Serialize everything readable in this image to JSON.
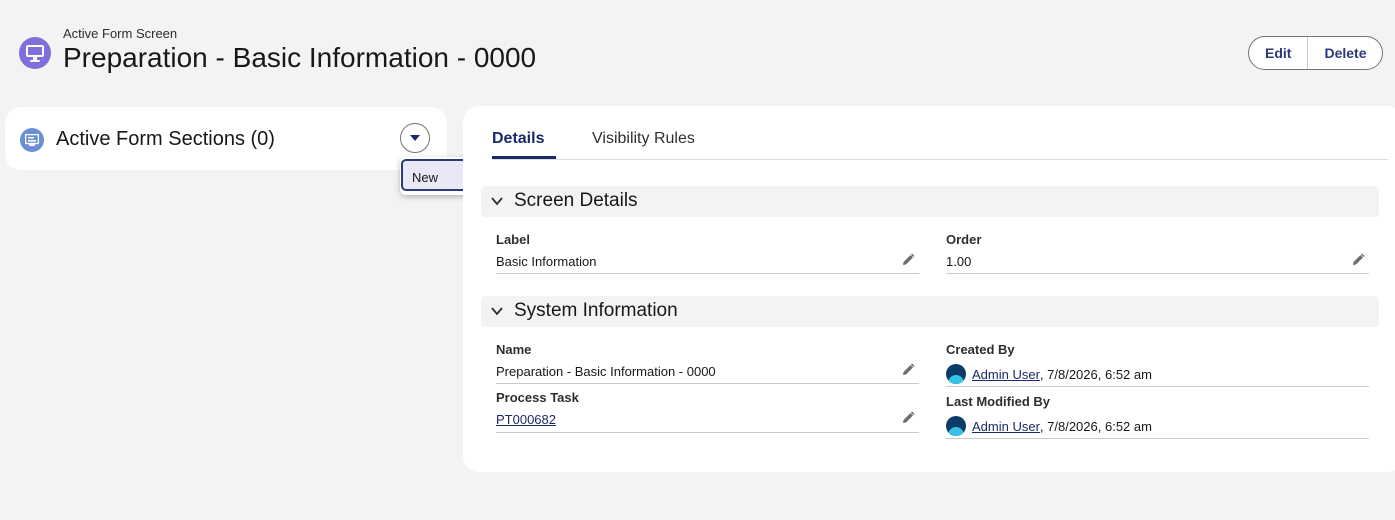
{
  "header": {
    "object_type": "Active Form Screen",
    "title": "Preparation - Basic Information - 0000",
    "icon": "monitor-icon",
    "buttons": {
      "edit": "Edit",
      "delete": "Delete"
    }
  },
  "related_list": {
    "title": "Active Form Sections (0)",
    "icon": "form-section-icon",
    "menu": {
      "items": [
        "New"
      ]
    }
  },
  "tabs": [
    {
      "label": "Details",
      "active": true
    },
    {
      "label": "Visibility Rules",
      "active": false
    }
  ],
  "sections": {
    "screen_details": {
      "title": "Screen Details",
      "label_field": {
        "label": "Label",
        "value": "Basic Information"
      },
      "order_field": {
        "label": "Order",
        "value": "1.00"
      }
    },
    "system_information": {
      "title": "System Information",
      "name_field": {
        "label": "Name",
        "value": "Preparation - Basic Information - 0000"
      },
      "process_task_field": {
        "label": "Process Task",
        "value": "PT000682"
      },
      "created_by": {
        "label": "Created By",
        "user": "Admin User",
        "timestamp": ", 7/8/2026, 6:52 am"
      },
      "last_modified_by": {
        "label": "Last Modified By",
        "user": "Admin User",
        "timestamp": ", 7/8/2026, 6:52 am"
      }
    }
  },
  "colors": {
    "brand": "#1b2a6b",
    "header_icon": "#7f6fdc",
    "section_icon": "#6b8fd6"
  }
}
